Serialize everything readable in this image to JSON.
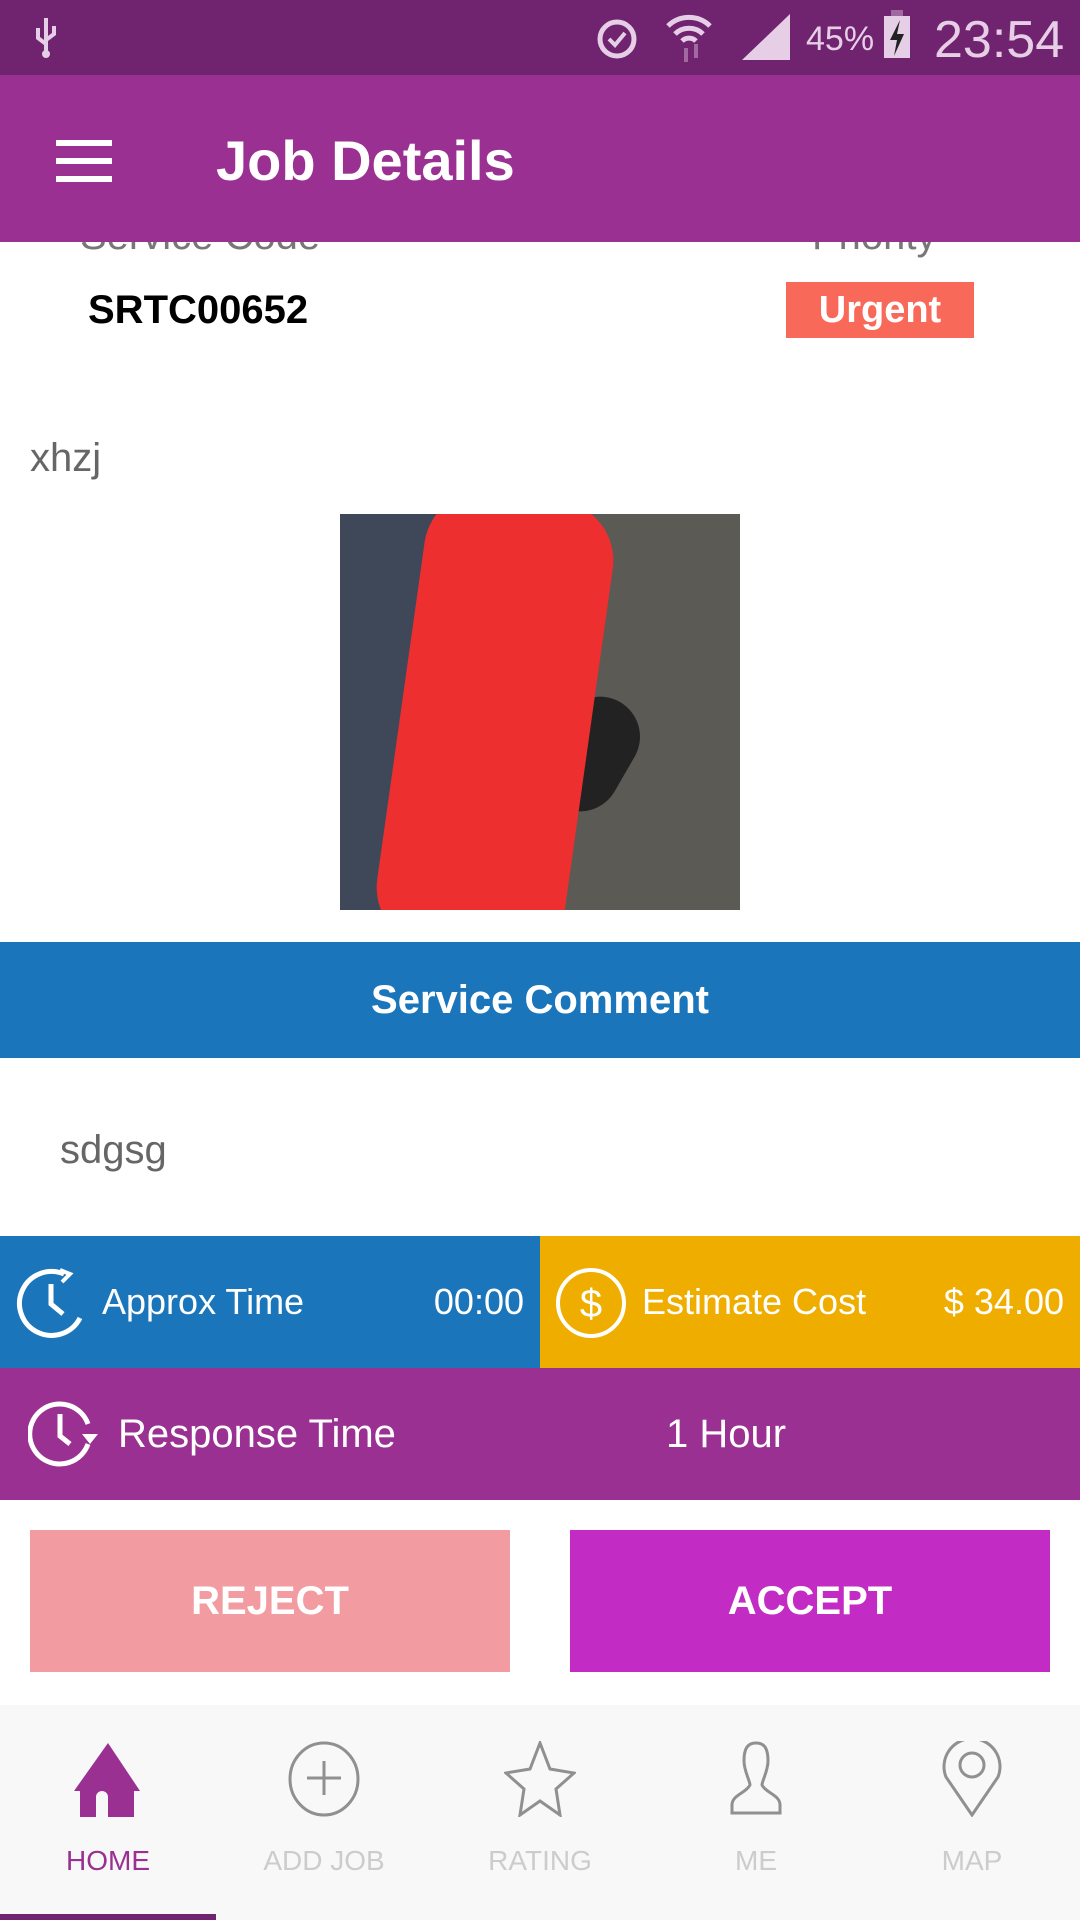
{
  "status_bar": {
    "battery": "45%",
    "time": "23:54",
    "icons": [
      "usb-icon",
      "alarm-icon",
      "wifi-icon",
      "signal-icon",
      "battery-charging-icon"
    ]
  },
  "app_bar": {
    "title": "Job Details",
    "menu_icon": "hamburger-icon"
  },
  "job": {
    "service_code_label": "Service Code",
    "service_code": "SRTC00652",
    "priority_label": "Priority",
    "priority": "Urgent",
    "description": "xhzj"
  },
  "comment": {
    "header": "Service Comment",
    "text": "sdgsg"
  },
  "info": {
    "approx_time_label": "Approx Time",
    "approx_time": "00:00",
    "estimate_cost_label": "Estimate Cost",
    "estimate_cost": "$ 34.00",
    "response_time_label": "Response Time",
    "response_time": "1 Hour"
  },
  "actions": {
    "reject": "REJECT",
    "accept": "ACCEPT"
  },
  "nav": {
    "items": [
      {
        "label": "HOME",
        "icon": "home-icon",
        "active": true
      },
      {
        "label": "ADD JOB",
        "icon": "add-circle-icon"
      },
      {
        "label": "RATING",
        "icon": "star-icon"
      },
      {
        "label": "ME",
        "icon": "person-icon"
      },
      {
        "label": "MAP",
        "icon": "map-pin-icon"
      }
    ]
  },
  "colors": {
    "primary": "#993092",
    "status": "#70236e",
    "blue": "#1b75bb",
    "amber": "#efad00",
    "urgent": "#f8695a",
    "reject": "#f29ba0",
    "accept": "#c22cc5"
  }
}
